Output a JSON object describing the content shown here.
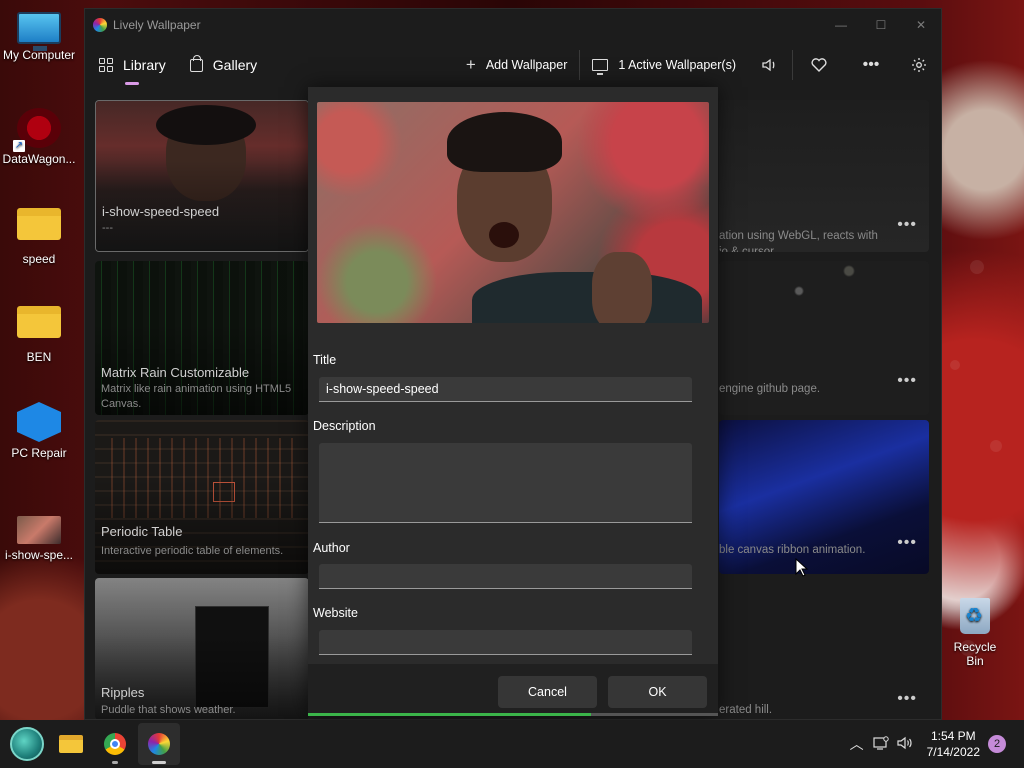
{
  "desktop": {
    "icons": [
      {
        "label": "My Computer",
        "icon": "monitor-icon"
      },
      {
        "label": "DataWagon...",
        "icon": "datawagon-icon"
      },
      {
        "label": "speed",
        "icon": "folder-icon"
      },
      {
        "label": "BEN",
        "icon": "folder-icon"
      },
      {
        "label": "PC Repair",
        "icon": "repair-icon"
      },
      {
        "label": "i-show-spe...",
        "icon": "image-thumbnail-icon"
      }
    ],
    "recycle_bin": "Recycle Bin"
  },
  "window": {
    "title": "Lively Wallpaper",
    "controls": {
      "minimize": "—",
      "maximize": "☐",
      "close": "✕"
    }
  },
  "nav": {
    "tabs": [
      {
        "label": "Library",
        "active": true
      },
      {
        "label": "Gallery",
        "active": false
      }
    ],
    "add_wallpaper": "Add Wallpaper",
    "active_wallpapers": "1 Active Wallpaper(s)"
  },
  "library": {
    "left_cards": [
      {
        "title": "i-show-speed-speed",
        "description": "---"
      },
      {
        "title": "Matrix Rain Customizable",
        "description": "Matrix like rain animation using HTML5 Canvas."
      },
      {
        "title": "Periodic Table",
        "description": "Interactive periodic table of elements."
      },
      {
        "title": "Ripples",
        "description": "Puddle that shows weather."
      }
    ],
    "right_cards": [
      {
        "description": "ation using WebGL, reacts with\nio & cursor.",
        "more": "•••"
      },
      {
        "description": "engine github page.",
        "more": "•••"
      },
      {
        "description": "ble canvas ribbon animation.",
        "more": "•••"
      },
      {
        "description": "erated hill.",
        "more": "•••"
      }
    ]
  },
  "dialog": {
    "title_label": "Title",
    "title_value": "i-show-speed-speed",
    "description_label": "Description",
    "description_value": "",
    "author_label": "Author",
    "author_value": "",
    "website_label": "Website",
    "website_value": "",
    "cancel": "Cancel",
    "ok": "OK",
    "progress": 0.69,
    "accent_progress": "#3bb54a"
  },
  "taskbar": {
    "apps": [
      "start-icon",
      "file-explorer-icon",
      "chrome-icon",
      "lively-wallpaper-icon"
    ],
    "clock_time": "1:54 PM",
    "clock_date": "7/14/2022",
    "notifications": "2"
  },
  "colors": {
    "app_bg": "#1c1c1c",
    "dialog_bg": "#2b2b2b",
    "active_tab_indicator": "#d99ae6"
  }
}
